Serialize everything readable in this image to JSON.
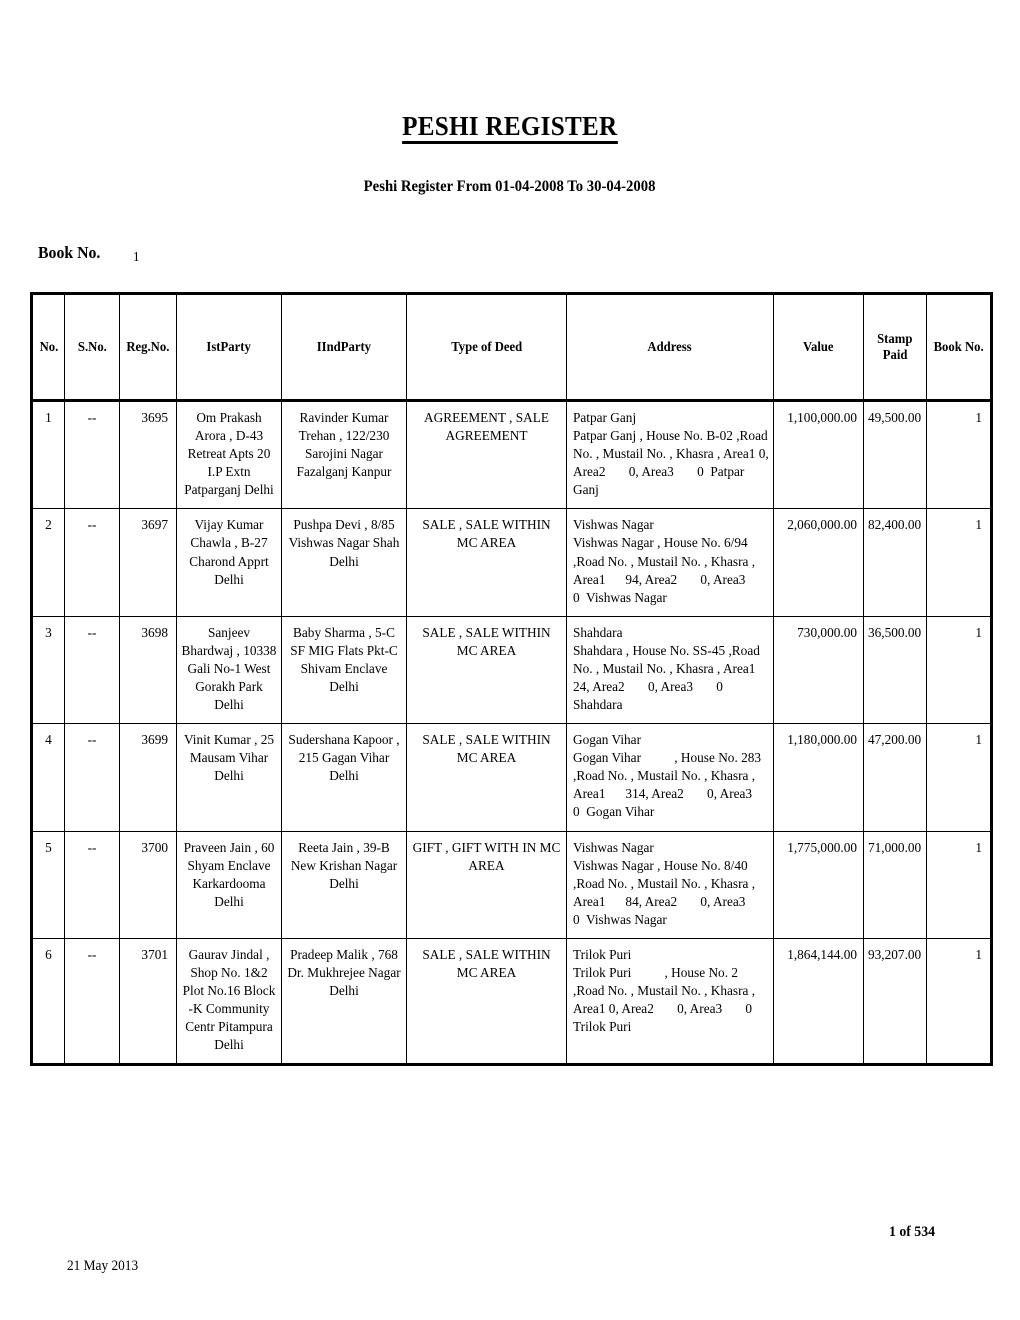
{
  "document": {
    "title": "PESHI REGISTER",
    "subtitle": "Peshi Register From 01-04-2008 To 30-04-2008",
    "book_no_label": "Book No.",
    "book_no_value": "1"
  },
  "table": {
    "columns": [
      "No.",
      "S.No.",
      "Reg.No.",
      "IstParty",
      "IIndParty",
      "Type of Deed",
      "Address",
      "Value",
      "Stamp Paid",
      "Book No."
    ],
    "stamp_paid_line1": "Stamp",
    "stamp_paid_line2": "Paid",
    "rows": [
      {
        "no": "1",
        "sno": "--",
        "reg_no": "3695",
        "ist_party": "Om Prakash Arora , D-43 Retreat Apts 20 I.P Extn Patparganj Delhi",
        "iind_party": "Ravinder Kumar Trehan  , 122/230 Sarojini Nagar Fazalganj Kanpur",
        "type_of_deed": "AGREEMENT , SALE AGREEMENT",
        "address": "Patpar Ganj\nPatpar Ganj , House No. B-02 ,Road No. , Mustail No. , Khasra , Area1 0, Area2       0, Area3       0  Patpar Ganj",
        "value": "1,100,000.00",
        "stamp_paid": "49,500.00",
        "book_no": "1"
      },
      {
        "no": "2",
        "sno": "--",
        "reg_no": "3697",
        "ist_party": "Vijay Kumar Chawla  , B-27 Charond  Apprt Delhi",
        "iind_party": "Pushpa Devi  , 8/85 Vishwas  Nagar Shah Delhi",
        "type_of_deed": "SALE , SALE WITHIN MC AREA",
        "address": "Vishwas Nagar\nVishwas Nagar , House No. 6/94 ,Road No. , Mustail No. , Khasra , Area1      94, Area2       0, Area3       0  Vishwas Nagar",
        "value": "2,060,000.00",
        "stamp_paid": "82,400.00",
        "book_no": "1"
      },
      {
        "no": "3",
        "sno": "--",
        "reg_no": "3698",
        "ist_party": "Sanjeev Bhardwaj , 10338 Gali  No-1 West Gorakh Park Delhi",
        "iind_party": "Baby Sharma  , 5-C SF  MIG Flats Pkt-C Shivam Enclave Delhi",
        "type_of_deed": "SALE , SALE WITHIN MC AREA",
        "address": "Shahdara\nShahdara , House No. SS-45 ,Road No. , Mustail No. , Khasra , Area1 24, Area2       0, Area3       0 Shahdara",
        "value": "730,000.00",
        "stamp_paid": "36,500.00",
        "book_no": "1"
      },
      {
        "no": "4",
        "sno": "--",
        "reg_no": "3699",
        "ist_party": "Vinit Kumar  , 25 Mausam Vihar Delhi",
        "iind_party": "Sudershana Kapoor  , 215 Gagan  Vihar Delhi",
        "type_of_deed": "SALE , SALE WITHIN MC AREA",
        "address": "Gogan Vihar\nGogan Vihar          , House No. 283 ,Road No. , Mustail No. , Khasra , Area1      314, Area2       0, Area3       0  Gogan Vihar",
        "value": "1,180,000.00",
        "stamp_paid": "47,200.00",
        "book_no": "1"
      },
      {
        "no": "5",
        "sno": "--",
        "reg_no": "3700",
        "ist_party": "Praveen Jain  , 60 Shyam  Enclave Karkardooma Delhi",
        "iind_party": "Reeta Jain  , 39-B New  Krishan Nagar Delhi",
        "type_of_deed": "GIFT , GIFT WITH IN MC AREA",
        "address": "Vishwas Nagar\nVishwas Nagar , House No. 8/40 ,Road No. , Mustail No. , Khasra , Area1      84, Area2       0, Area3       0  Vishwas Nagar",
        "value": "1,775,000.00",
        "stamp_paid": "71,000.00",
        "book_no": "1"
      },
      {
        "no": "6",
        "sno": "--",
        "reg_no": "3701",
        "ist_party": "Gaurav Jindal   ,  Shop No.  1&2 Plot No.16  Block -K  Community Centr Pitampura Delhi",
        "iind_party": "Pradeep Malik   , 768 Dr. Mukhrejee Nagar Delhi",
        "type_of_deed": "SALE , SALE WITHIN MC AREA",
        "address": "Trilok Puri\nTrilok Puri          , House No. 2  ,Road No. , Mustail No. , Khasra , Area1 0, Area2       0, Area3       0  Trilok Puri",
        "value": "1,864,144.00",
        "stamp_paid": "93,207.00",
        "book_no": "1"
      }
    ]
  },
  "footer": {
    "page_count": "1  of  534",
    "date": "21  May  2013"
  }
}
